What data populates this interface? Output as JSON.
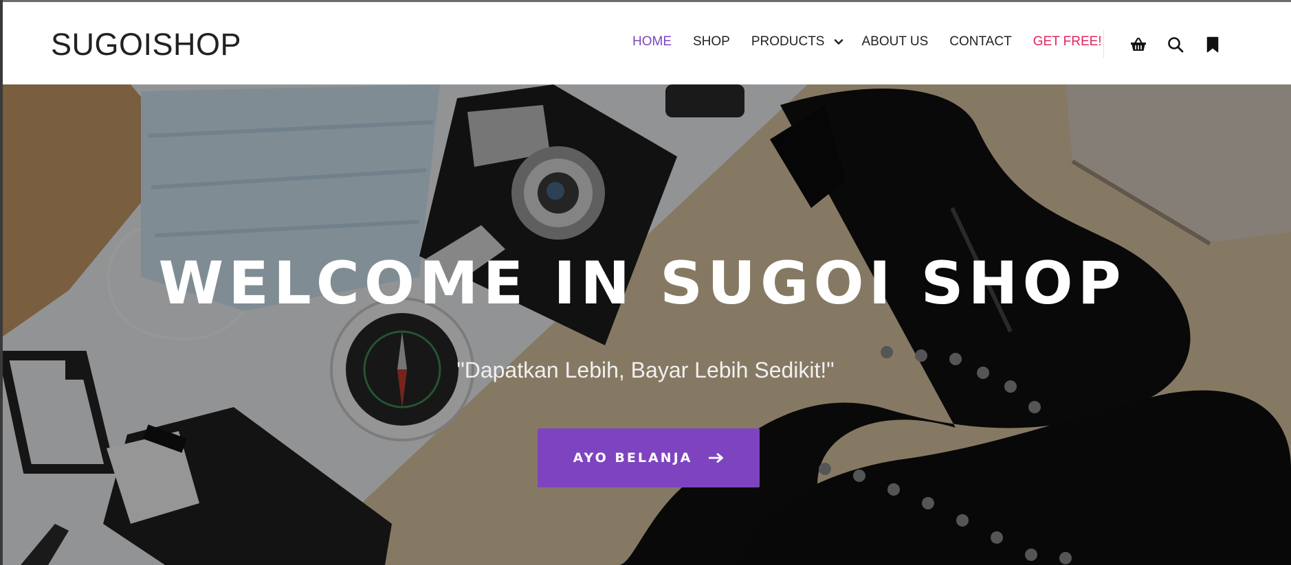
{
  "brand": {
    "logo_text": "SUGOISHOP",
    "accent": "#7e44c0",
    "highlight": "#e0245e"
  },
  "nav": {
    "items": [
      {
        "label": "HOME",
        "active": true
      },
      {
        "label": "SHOP"
      },
      {
        "label": "PRODUCTS",
        "has_dropdown": true
      },
      {
        "label": "ABOUT US"
      },
      {
        "label": "CONTACT"
      },
      {
        "label": "GET FREE!",
        "highlight": true
      }
    ],
    "icons": [
      "basket-icon",
      "search-icon",
      "bookmark-icon"
    ]
  },
  "hero": {
    "title": "WELCOME IN SUGOI SHOP",
    "subtitle": "\"Dapatkan Lebih, Bayar Lebih Sedikit!\"",
    "cta_label": "AYO BELANJA",
    "cta_icon": "arrow-right-icon"
  }
}
